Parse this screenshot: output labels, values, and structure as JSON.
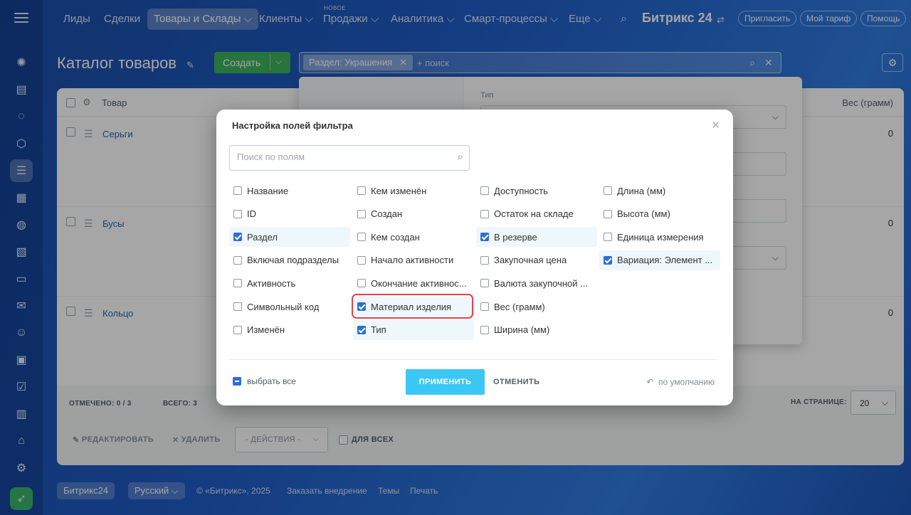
{
  "nav": {
    "items": [
      "Лиды",
      "Сделки",
      "Товары и Склады",
      "Клиенты",
      "Продажи",
      "Аналитика",
      "Смарт-процессы",
      "Еще"
    ],
    "chev": "⌵",
    "new_badge": "НОВОЕ",
    "brand": "Битрикс 24",
    "buttons": [
      "Пригласить",
      "Мой тариф",
      "Помощь"
    ]
  },
  "page": {
    "title": "Каталог товаров",
    "create_label": "Создать",
    "filter_chip": "Раздел: Украшения",
    "filter_placeholder": "+ поиск"
  },
  "grid": {
    "col_product": "Товар",
    "col_weight": "Вес (грамм)",
    "rows": [
      {
        "name": "Серьги",
        "weight": "0"
      },
      {
        "name": "Бусы",
        "weight": "0"
      },
      {
        "name": "Кольцо",
        "weight": "0"
      }
    ]
  },
  "grid_footer": {
    "marked": "ОТМЕЧЕНО: 0 / 3",
    "total": "ВСЕГО: 3",
    "per_page_label": "НА СТРАНИЦЕ:",
    "per_page": "20",
    "edit": "РЕДАКТИРОВАТЬ",
    "delete": "УДАЛИТЬ",
    "actions": "- ДЕЙСТВИЯ -",
    "for_all": "ДЛЯ ВСЕХ"
  },
  "footer": {
    "brand": "Битрикс24",
    "language": "Русский",
    "copyright": "© «Битрикс», 2025",
    "links": [
      "Заказать внедрение",
      "Темы",
      "Печать"
    ]
  },
  "filter_panel": {
    "type_label": "Тип"
  },
  "modal": {
    "title": "Настройка полей фильтра",
    "search_placeholder": "Поиск по полям",
    "columns": [
      [
        {
          "label": "Название",
          "checked": false
        },
        {
          "label": "ID",
          "checked": false
        },
        {
          "label": "Раздел",
          "checked": true
        },
        {
          "label": "Включая подразделы",
          "checked": false
        },
        {
          "label": "Активность",
          "checked": false
        },
        {
          "label": "Символьный код",
          "checked": false
        },
        {
          "label": "Изменён",
          "checked": false
        }
      ],
      [
        {
          "label": "Кем изменён",
          "checked": false
        },
        {
          "label": "Создан",
          "checked": false
        },
        {
          "label": "Кем создан",
          "checked": false
        },
        {
          "label": "Начало активности",
          "checked": false
        },
        {
          "label": "Окончание активнос...",
          "checked": false
        },
        {
          "label": "Материал изделия",
          "checked": true
        },
        {
          "label": "Тип",
          "checked": true
        }
      ],
      [
        {
          "label": "Доступность",
          "checked": false
        },
        {
          "label": "Остаток на складе",
          "checked": false
        },
        {
          "label": "В резерве",
          "checked": true
        },
        {
          "label": "Закупочная цена",
          "checked": false
        },
        {
          "label": "Валюта закупочной ...",
          "checked": false
        },
        {
          "label": "Вес (грамм)",
          "checked": false
        },
        {
          "label": "Ширина (мм)",
          "checked": false
        }
      ],
      [
        {
          "label": "Длина (мм)",
          "checked": false
        },
        {
          "label": "Высота (мм)",
          "checked": false
        },
        {
          "label": "Единица измерения",
          "checked": false
        },
        {
          "label": "Вариация: Элемент ...",
          "checked": true
        }
      ]
    ],
    "select_all": "выбрать все",
    "apply": "ПРИМЕНИТЬ",
    "cancel": "ОТМЕНИТЬ",
    "default": "по умолчанию"
  }
}
